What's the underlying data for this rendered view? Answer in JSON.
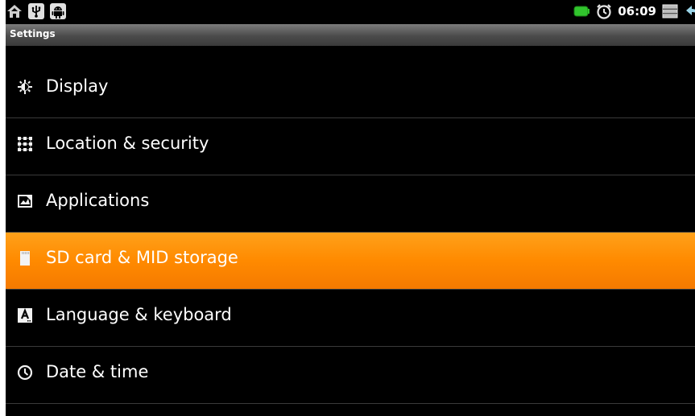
{
  "status_bar": {
    "left_icons": [
      "home-icon",
      "usb-icon",
      "android-icon"
    ],
    "right_icons": [
      "battery-icon",
      "alarm-icon",
      "menu-icon",
      "back-icon"
    ],
    "time": "06:09"
  },
  "title_bar": {
    "title": "Settings"
  },
  "settings_list": [
    {
      "label": "Display",
      "icon": "brightness-icon",
      "selected": false
    },
    {
      "label": "Location & security",
      "icon": "lock-pattern-icon",
      "selected": false
    },
    {
      "label": "Applications",
      "icon": "applications-icon",
      "selected": false
    },
    {
      "label": "SD card & MID storage",
      "icon": "sd-card-icon",
      "selected": true
    },
    {
      "label": "Language & keyboard",
      "icon": "keyboard-icon",
      "selected": false
    },
    {
      "label": "Date & time",
      "icon": "clock-icon",
      "selected": false
    }
  ],
  "colors": {
    "selection": "#ff8a00",
    "background": "#000000",
    "divider": "#3a3a3a",
    "text": "#ffffff"
  }
}
